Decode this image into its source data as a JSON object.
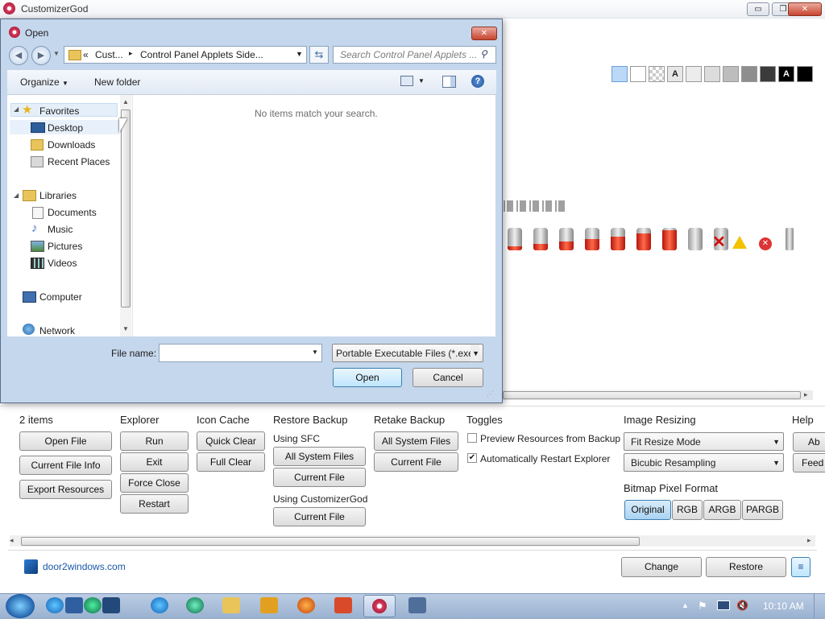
{
  "app": {
    "title": "CustomizerGod"
  },
  "window_controls": {
    "minimize": "▭",
    "maximize": "❐",
    "close": "✕"
  },
  "swatches": [
    "#bcd8f7",
    "#ffffff",
    "checker",
    "A",
    "#ececec",
    "#dcdcdc",
    "#bdbdbd",
    "#8e8e8e",
    "#3b3b3b",
    "A",
    "#000000"
  ],
  "dialog": {
    "title": "Open",
    "close": "✕",
    "breadcrumb": {
      "prefix": "«",
      "part1": "Cust...",
      "sep": "▸",
      "part2": "Control Panel Applets Side..."
    },
    "search_placeholder": "Search Control Panel Applets ...",
    "organize": "Organize",
    "new_folder": "New folder",
    "empty_message": "No items match your search.",
    "nav": {
      "favorites": "Favorites",
      "desktop": "Desktop",
      "downloads": "Downloads",
      "recent_places": "Recent Places",
      "libraries": "Libraries",
      "documents": "Documents",
      "music": "Music",
      "pictures": "Pictures",
      "videos": "Videos",
      "computer": "Computer",
      "network": "Network"
    },
    "file_name_label": "File name:",
    "file_name_value": "",
    "file_type": "Portable Executable Files (*.exe;",
    "open_button": "Open",
    "cancel_button": "Cancel"
  },
  "panel": {
    "item_count": "2 items",
    "buttons_col1": [
      "Open File",
      "Current File Info",
      "Export Resources"
    ],
    "explorer": {
      "title": "Explorer",
      "buttons": [
        "Run",
        "Exit",
        "Force Close",
        "Restart"
      ]
    },
    "icon_cache": {
      "title": "Icon Cache",
      "buttons": [
        "Quick Clear",
        "Full Clear"
      ]
    },
    "restore_backup": {
      "title": "Restore Backup",
      "using_sfc": "Using SFC",
      "sfc_buttons": [
        "All System Files",
        "Current File"
      ],
      "using_cg": "Using CustomizerGod",
      "cg_buttons": [
        "Current File"
      ]
    },
    "retake_backup": {
      "title": "Retake Backup",
      "buttons": [
        "All System Files",
        "Current File"
      ]
    },
    "toggles": {
      "title": "Toggles",
      "items": [
        {
          "label": "Preview Resources from Backup",
          "checked": false,
          "mark": ""
        },
        {
          "label": "Automatically Restart Explorer",
          "checked": true,
          "mark": "✔"
        }
      ]
    },
    "image_resizing": {
      "title": "Image Resizing",
      "mode": "Fit Resize Mode",
      "resampling": "Bicubic Resampling",
      "pixel_format_title": "Bitmap Pixel Format",
      "formats": [
        "Original",
        "RGB",
        "ARGB",
        "PARGB"
      ],
      "selected_format": "Original"
    },
    "help": {
      "title": "Help",
      "buttons": [
        "Ab",
        "Feed"
      ]
    }
  },
  "footer": {
    "link": "door2windows.com",
    "change": "Change",
    "restore": "Restore",
    "menu_icon": "≡"
  },
  "battery_levels": [
    0.18,
    0.3,
    0.4,
    0.5,
    0.62,
    0.75,
    0.88,
    0,
    0
  ],
  "taskbar": {
    "clock": "10:10 AM"
  }
}
